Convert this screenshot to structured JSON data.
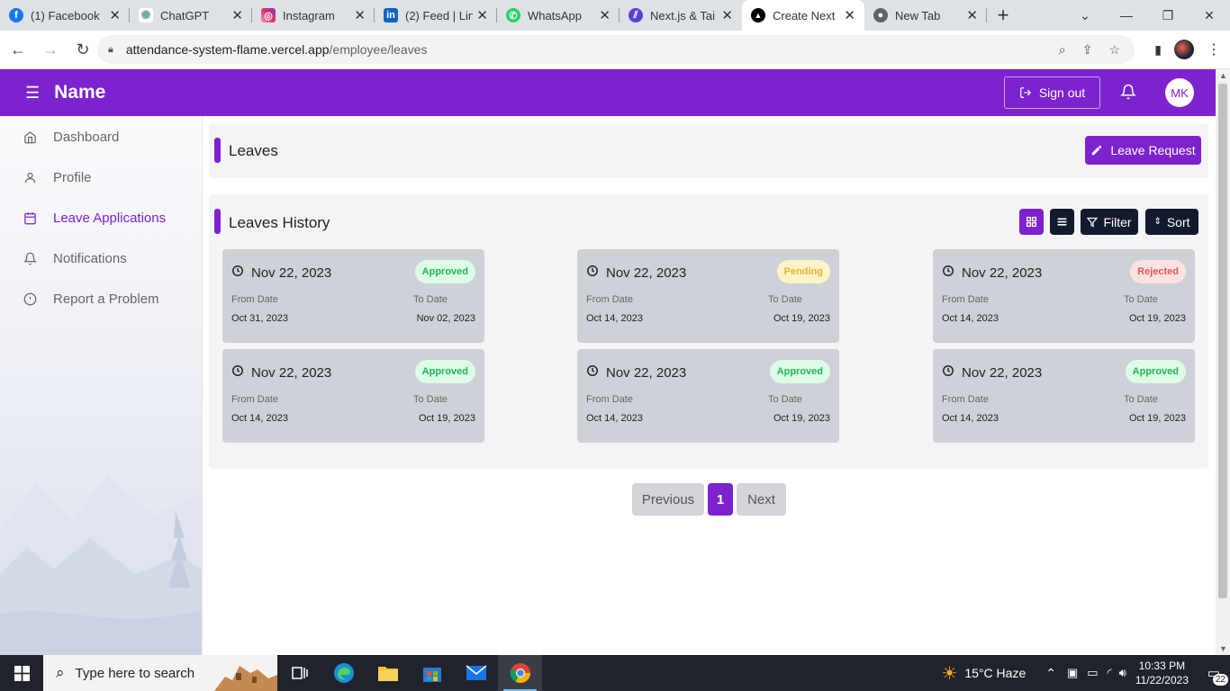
{
  "browser": {
    "tabs": [
      {
        "label": "(1) Facebook",
        "icon": "facebook-icon",
        "color": "#1877f2"
      },
      {
        "label": "ChatGPT",
        "icon": "chatgpt-icon",
        "color": "#74aa9c"
      },
      {
        "label": "Instagram",
        "icon": "instagram-icon",
        "color": "#e1306c"
      },
      {
        "label": "(2) Feed | Lin",
        "icon": "linkedin-icon",
        "color": "#0a66c2"
      },
      {
        "label": "WhatsApp",
        "icon": "whatsapp-icon",
        "color": "#25d366"
      },
      {
        "label": "Next.js & Tai",
        "icon": "stripes-icon",
        "color": "#5b3fd6"
      },
      {
        "label": "Create Next",
        "icon": "vercel-icon",
        "color": "#000000"
      },
      {
        "label": "New Tab",
        "icon": "chrome-icon",
        "color": "#5f6368"
      }
    ],
    "url_host": "attendance-system-flame.vercel.app",
    "url_path": "/employee/leaves"
  },
  "header": {
    "app_name": "Name",
    "sign_out": "Sign out",
    "avatar_initials": "MK",
    "brand_color": "#7c22cf"
  },
  "sidebar": {
    "items": [
      {
        "label": "Dashboard",
        "icon": "home-icon",
        "active": false
      },
      {
        "label": "Profile",
        "icon": "user-icon",
        "active": false
      },
      {
        "label": "Leave Applications",
        "icon": "calendar-icon",
        "active": true
      },
      {
        "label": "Notifications",
        "icon": "bell-icon",
        "active": false
      },
      {
        "label": "Report a Problem",
        "icon": "alert-circle-icon",
        "active": false
      }
    ]
  },
  "leaves": {
    "title": "Leaves",
    "request_button": "Leave Request",
    "history_title": "Leaves History",
    "filter_label": "Filter",
    "sort_label": "Sort",
    "from_label": "From Date",
    "to_label": "To Date",
    "cards": [
      {
        "date": "Nov 22, 2023",
        "status": "Approved",
        "from": "Oct 31, 2023",
        "to": "Nov 02, 2023"
      },
      {
        "date": "Nov 22, 2023",
        "status": "Pending",
        "from": "Oct 14, 2023",
        "to": "Oct 19, 2023"
      },
      {
        "date": "Nov 22, 2023",
        "status": "Rejected",
        "from": "Oct 14, 2023",
        "to": "Oct 19, 2023"
      },
      {
        "date": "Nov 22, 2023",
        "status": "Approved",
        "from": "Oct 14, 2023",
        "to": "Oct 19, 2023"
      },
      {
        "date": "Nov 22, 2023",
        "status": "Approved",
        "from": "Oct 14, 2023",
        "to": "Oct 19, 2023"
      },
      {
        "date": "Nov 22, 2023",
        "status": "Approved",
        "from": "Oct 14, 2023",
        "to": "Oct 19, 2023"
      }
    ]
  },
  "pagination": {
    "previous": "Previous",
    "current": "1",
    "next": "Next"
  },
  "taskbar": {
    "search_placeholder": "Type here to search",
    "weather": "15°C  Haze",
    "time": "10:33 PM",
    "date": "11/22/2023",
    "notif_count": "22"
  }
}
